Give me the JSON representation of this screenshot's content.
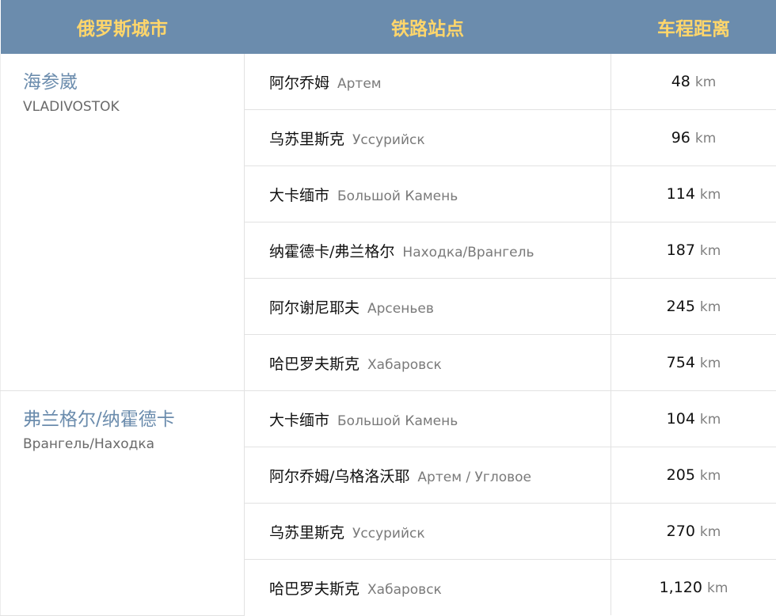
{
  "headers": {
    "city": "俄罗斯城市",
    "station": "铁路站点",
    "distance": "车程距离"
  },
  "unit": "km",
  "groups": [
    {
      "city_cn": "海参崴",
      "city_en": "VLADIVOSTOK",
      "rows": [
        {
          "cn": "阿尔乔姆",
          "ru": "Артем",
          "km": "48"
        },
        {
          "cn": "乌苏里斯克",
          "ru": "Уссурийск",
          "km": "96"
        },
        {
          "cn": "大卡缅市",
          "ru": "Большой Камень",
          "km": "114"
        },
        {
          "cn": "纳霍德卡/弗兰格尔",
          "ru": "Находка/Врангель",
          "km": "187"
        },
        {
          "cn": "阿尔谢尼耶夫",
          "ru": "Арсеньев",
          "km": "245"
        },
        {
          "cn": "哈巴罗夫斯克",
          "ru": "Хабаровск",
          "km": "754"
        }
      ]
    },
    {
      "city_cn": "弗兰格尔/纳霍德卡",
      "city_en": "Врангель/Находка",
      "rows": [
        {
          "cn": "大卡缅市",
          "ru": "Большой Камень",
          "km": "104"
        },
        {
          "cn": "阿尔乔姆/乌格洛沃耶",
          "ru": "Артем / Угловое",
          "km": "205"
        },
        {
          "cn": "乌苏里斯克",
          "ru": "Уссурийск",
          "km": "270"
        },
        {
          "cn": "哈巴罗夫斯克",
          "ru": "Хабаровск",
          "km": "1,120"
        }
      ]
    }
  ]
}
